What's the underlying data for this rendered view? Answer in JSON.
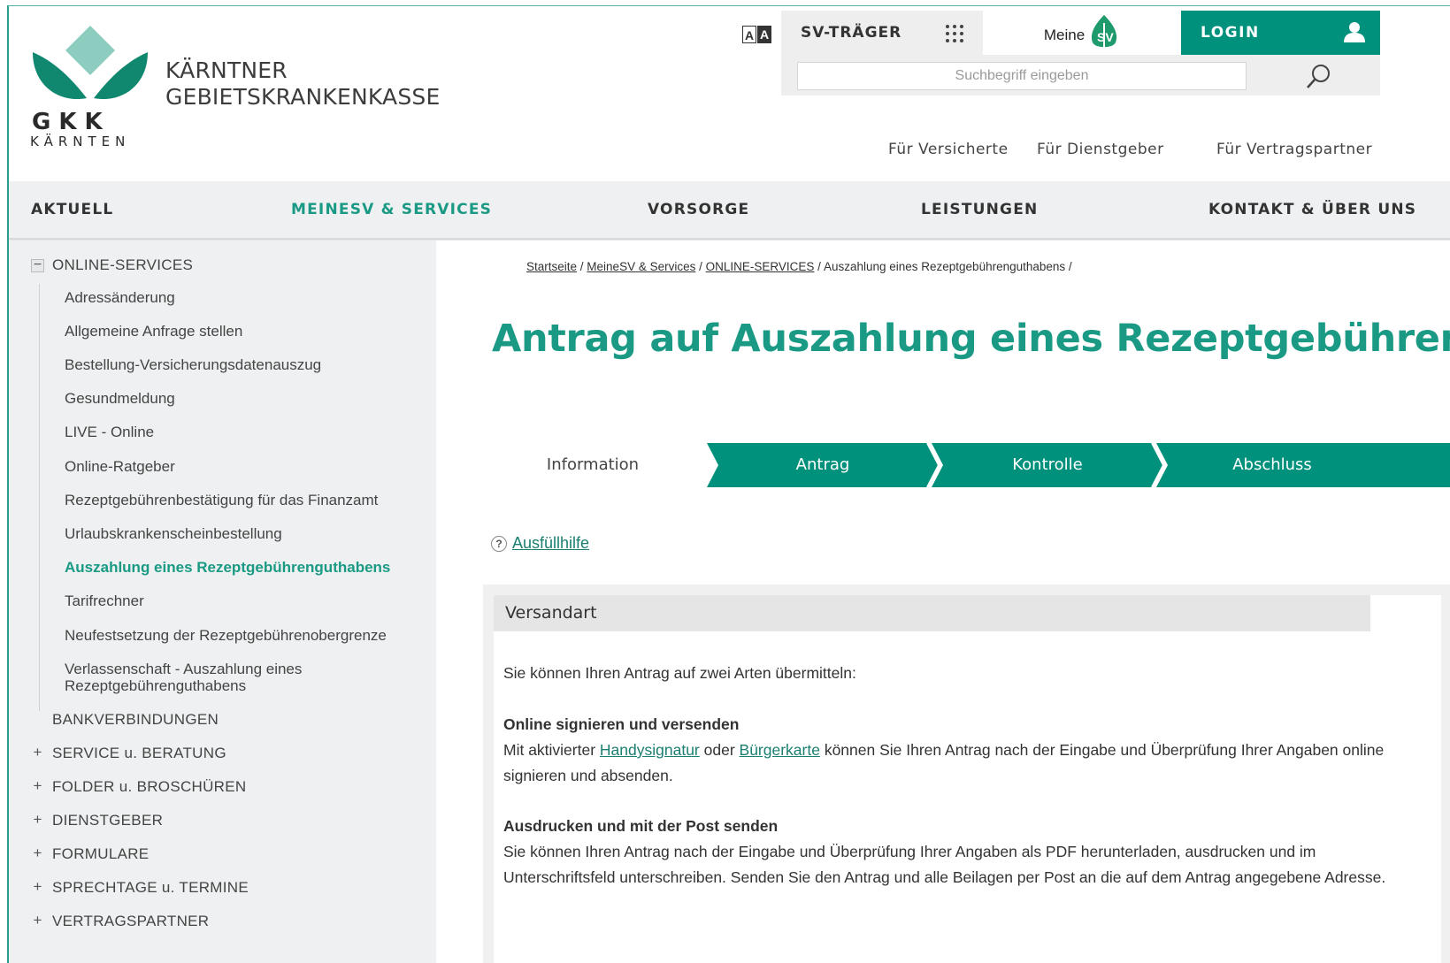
{
  "brand": {
    "name_line1": "KÄRNTNER",
    "name_line2": "GEBIETSKRANKENKASSE",
    "short": "GKK",
    "region": "KÄRNTEN",
    "accent": "#00917d",
    "logo_light": "#8dcdbf",
    "logo_dark": "#10876f"
  },
  "topbar": {
    "font_toggle": [
      "A",
      "A"
    ],
    "sv_traeger_label": "SV-TRÄGER",
    "meine_label": "Meine",
    "meine_badge": "SV",
    "login_label": "LOGIN",
    "search_placeholder": "Suchbegriff eingeben"
  },
  "audience": [
    "Für Versicherte",
    "Für Dienstgeber",
    "Für Vertragspartner"
  ],
  "mainnav": [
    {
      "label": "AKTUELL",
      "active": false
    },
    {
      "label": "MEINESV & SERVICES",
      "active": true
    },
    {
      "label": "VORSORGE",
      "active": false
    },
    {
      "label": "LEISTUNGEN",
      "active": false
    },
    {
      "label": "KONTAKT & ÜBER UNS",
      "active": false
    }
  ],
  "sidebar": {
    "section": {
      "label": "ONLINE-SERVICES",
      "toggle": "−"
    },
    "subitems": [
      {
        "label": "Adressänderung"
      },
      {
        "label": "Allgemeine Anfrage stellen"
      },
      {
        "label": "Bestellung-Versicherungsdatenauszug"
      },
      {
        "label": "Gesundmeldung"
      },
      {
        "label": "LIVE - Online"
      },
      {
        "label": "Online-Ratgeber"
      },
      {
        "label": "Rezeptgebührenbestätigung für das Finanzamt"
      },
      {
        "label": "Urlaubskrankenscheinbestellung"
      },
      {
        "label": "Auszahlung eines Rezeptgebührenguthabens",
        "active": true
      },
      {
        "label": "Tarifrechner"
      },
      {
        "label": "Neufestsetzung der Rezeptgebührenobergrenze"
      },
      {
        "label": "Verlassenschaft - Auszahlung eines",
        "label2": "Rezeptgebührenguthabens"
      }
    ],
    "sections": [
      {
        "label": "BANKVERBINDUNGEN",
        "toggle": ""
      },
      {
        "label": "SERVICE u. BERATUNG",
        "toggle": "+"
      },
      {
        "label": "FOLDER u. BROSCHÜREN",
        "toggle": "+"
      },
      {
        "label": "DIENSTGEBER",
        "toggle": "+"
      },
      {
        "label": "FORMULARE",
        "toggle": "+"
      },
      {
        "label": "SPRECHTAGE u. TERMINE",
        "toggle": "+"
      },
      {
        "label": "VERTRAGSPARTNER",
        "toggle": "+"
      }
    ]
  },
  "breadcrumb": {
    "items": [
      "Startseite",
      "MeineSV & Services",
      "ONLINE-SERVICES"
    ],
    "current": "Auszahlung eines Rezeptgebührenguthabens",
    "sep": " / "
  },
  "page_title": "Antrag auf Auszahlung eines Rezeptgebührenguthabens",
  "steps": [
    "Information",
    "Antrag",
    "Kontrolle",
    "Abschluss"
  ],
  "help": {
    "icon": "?",
    "label": "Ausfüllhilfe"
  },
  "versandart": {
    "heading": "Versandart",
    "intro": "Sie können Ihren Antrag auf zwei Arten übermitteln:",
    "online_title": "Online signieren und versenden",
    "online_pre": "Mit aktivierter ",
    "online_link1": "Handysignatur",
    "online_mid": " oder ",
    "online_link2": "Bürgerkarte",
    "online_post": " können Sie Ihren Antrag nach der Eingabe und Überprüfung Ihrer Angaben online signieren und absenden.",
    "post_title": "Ausdrucken und mit der Post senden",
    "post_text": "Sie können Ihren Antrag nach der Eingabe und Überprüfung Ihrer Angaben als PDF herunterladen, ausdrucken und im Unterschriftsfeld unterschreiben. Senden Sie den Antrag und alle Beilagen per Post an die auf dem Antrag angegebene Adresse."
  }
}
